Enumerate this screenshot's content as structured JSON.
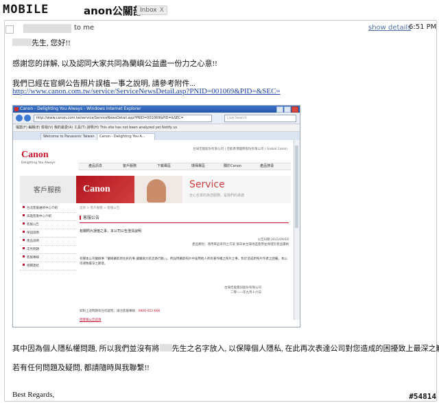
{
  "header": {
    "logo_text": "MOBILE",
    "subject": "anon公關部",
    "inbox_label": "Inbox",
    "inbox_close": "X"
  },
  "message": {
    "recipient": "to me",
    "show_details": "show details",
    "time": "6:51 PM",
    "greeting_suffix": "先生, 您好!!",
    "para1": "感謝您的詳解, 以及認同大家共同為蘭嶼公益盡一份力之心意!!",
    "para2": "我們已經在官網公告照片誤植一事之說明, 請參考附件...",
    "link": "http://www.canon.com.tw/service/ServiceNewsDetail.asp?PNID=001069&PID=&SEC=",
    "para3_before": "其中因為個人隱私權問題, 所以我們並沒有將",
    "para3_after": "先生之名字放入, 以保障個人隱私, 在此再次表達公司對您造成的困擾致上最深之歉意...",
    "para4": "若有任何問題及疑問, 都請隨時與我聯繫!!",
    "closing": "Best Regards,"
  },
  "embedded_screenshot": {
    "window_title": "Canon - Delighting You Always - Windows Internet Explorer",
    "address": "http://www.canon.com.tw/service/ServiceNewsDetail.asp?PNID=001069&PID=&SEC=",
    "search_placeholder": "Live Search",
    "menu_text": "檔案(F)  編輯(E)  檢視(V)  我的最愛(A)  工具(T)  說明(H)      This site has not been analyzed yet    Notify us",
    "tabs": [
      "Welcome to Panasonic Taiwan",
      "Canon - Delighting You A..."
    ],
    "site": {
      "logo": "Canon",
      "tagline": "Delighting You Always",
      "top_links": "台灣佳能股份有限公司  |  佳能香港國際股份有限公司  |  Global Canon",
      "nav": [
        "產品訊息",
        "客戶服務",
        "下載專區",
        "環保專區",
        "關於Canon",
        "產品搜尋"
      ],
      "section_title": "客戶服務",
      "banner_logo": "Canon",
      "banner_service": "Service",
      "banner_sub": "全心全意的為您服務，是我們的承諾",
      "side_menu": [
        "台北客服維修中心介紹",
        "高雄客服中心介紹",
        "客服公告",
        "保固說明",
        "產品說明",
        "常見問題",
        "客服專線",
        "相關連結"
      ],
      "breadcrumb": "首頁 > 客戶服務 > 客服公告",
      "content_title": "客服公告",
      "news_title": "有關照片誤植之事，本公司公告澄清說明",
      "news_date": "公告日期  2011/09/16",
      "news_category": "產品類別：適用單品系列之方案 限日本台灣地區使用並保證於產品價格",
      "news_body": "有關本公司蘭嶼事「蘭嶼攝影原住民的事 讓蘭嶼大航走路行動」」，所誤用攝影照片中誤用他人所有著作權之照片之事，對於造成原照片作者之困擾，本公司謹致最深之歉意。",
      "signature_company": "台灣佳能資訊股份有限公司",
      "signature_date": "二零一一年九月十六日",
      "contact_text": "如對上述問題有任何疑問，請洽客服專線：",
      "contact_hotline": "0800-022-666",
      "back_link": "回客服公告首頁"
    }
  },
  "watermark": "#54814"
}
